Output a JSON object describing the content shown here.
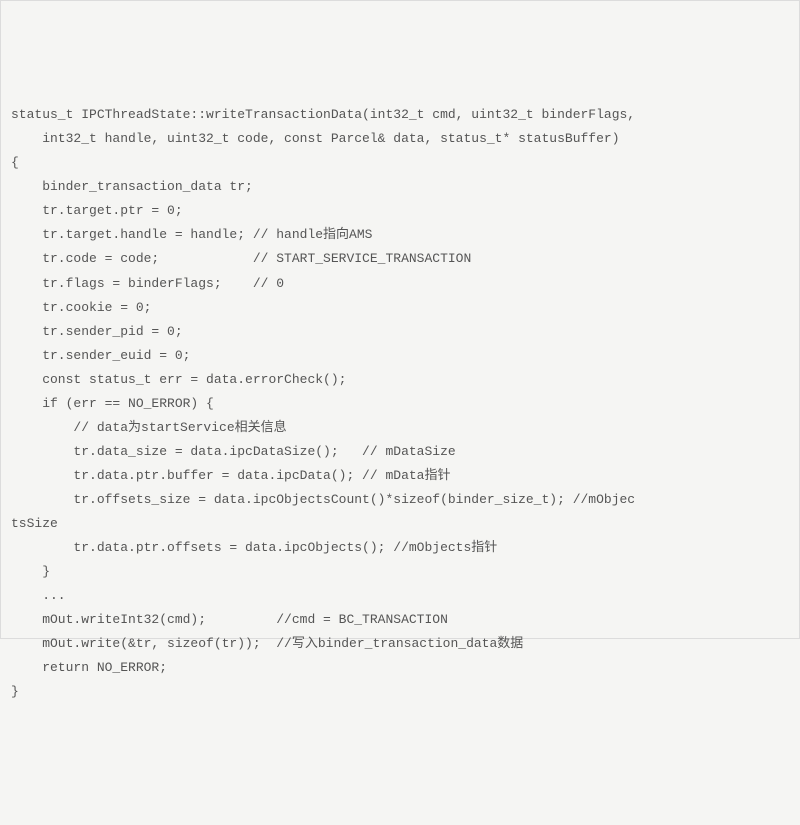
{
  "code": {
    "lines": [
      "status_t IPCThreadState::writeTransactionData(int32_t cmd, uint32_t binderFlags,",
      "    int32_t handle, uint32_t code, const Parcel& data, status_t* statusBuffer)",
      "{",
      "    binder_transaction_data tr;",
      "",
      "    tr.target.ptr = 0;",
      "    tr.target.handle = handle; // handle指向AMS",
      "    tr.code = code;            // START_SERVICE_TRANSACTION",
      "    tr.flags = binderFlags;    // 0",
      "    tr.cookie = 0;",
      "    tr.sender_pid = 0;",
      "    tr.sender_euid = 0;",
      "",
      "    const status_t err = data.errorCheck();",
      "    if (err == NO_ERROR) {",
      "        // data为startService相关信息",
      "        tr.data_size = data.ipcDataSize();   // mDataSize",
      "        tr.data.ptr.buffer = data.ipcData(); // mData指针",
      "        tr.offsets_size = data.ipcObjectsCount()*sizeof(binder_size_t); //mObjec",
      "tsSize",
      "        tr.data.ptr.offsets = data.ipcObjects(); //mObjects指针",
      "    }",
      "    ...",
      "    mOut.writeInt32(cmd);         //cmd = BC_TRANSACTION",
      "    mOut.write(&tr, sizeof(tr));  //写入binder_transaction_data数据",
      "    return NO_ERROR;",
      "}"
    ]
  }
}
